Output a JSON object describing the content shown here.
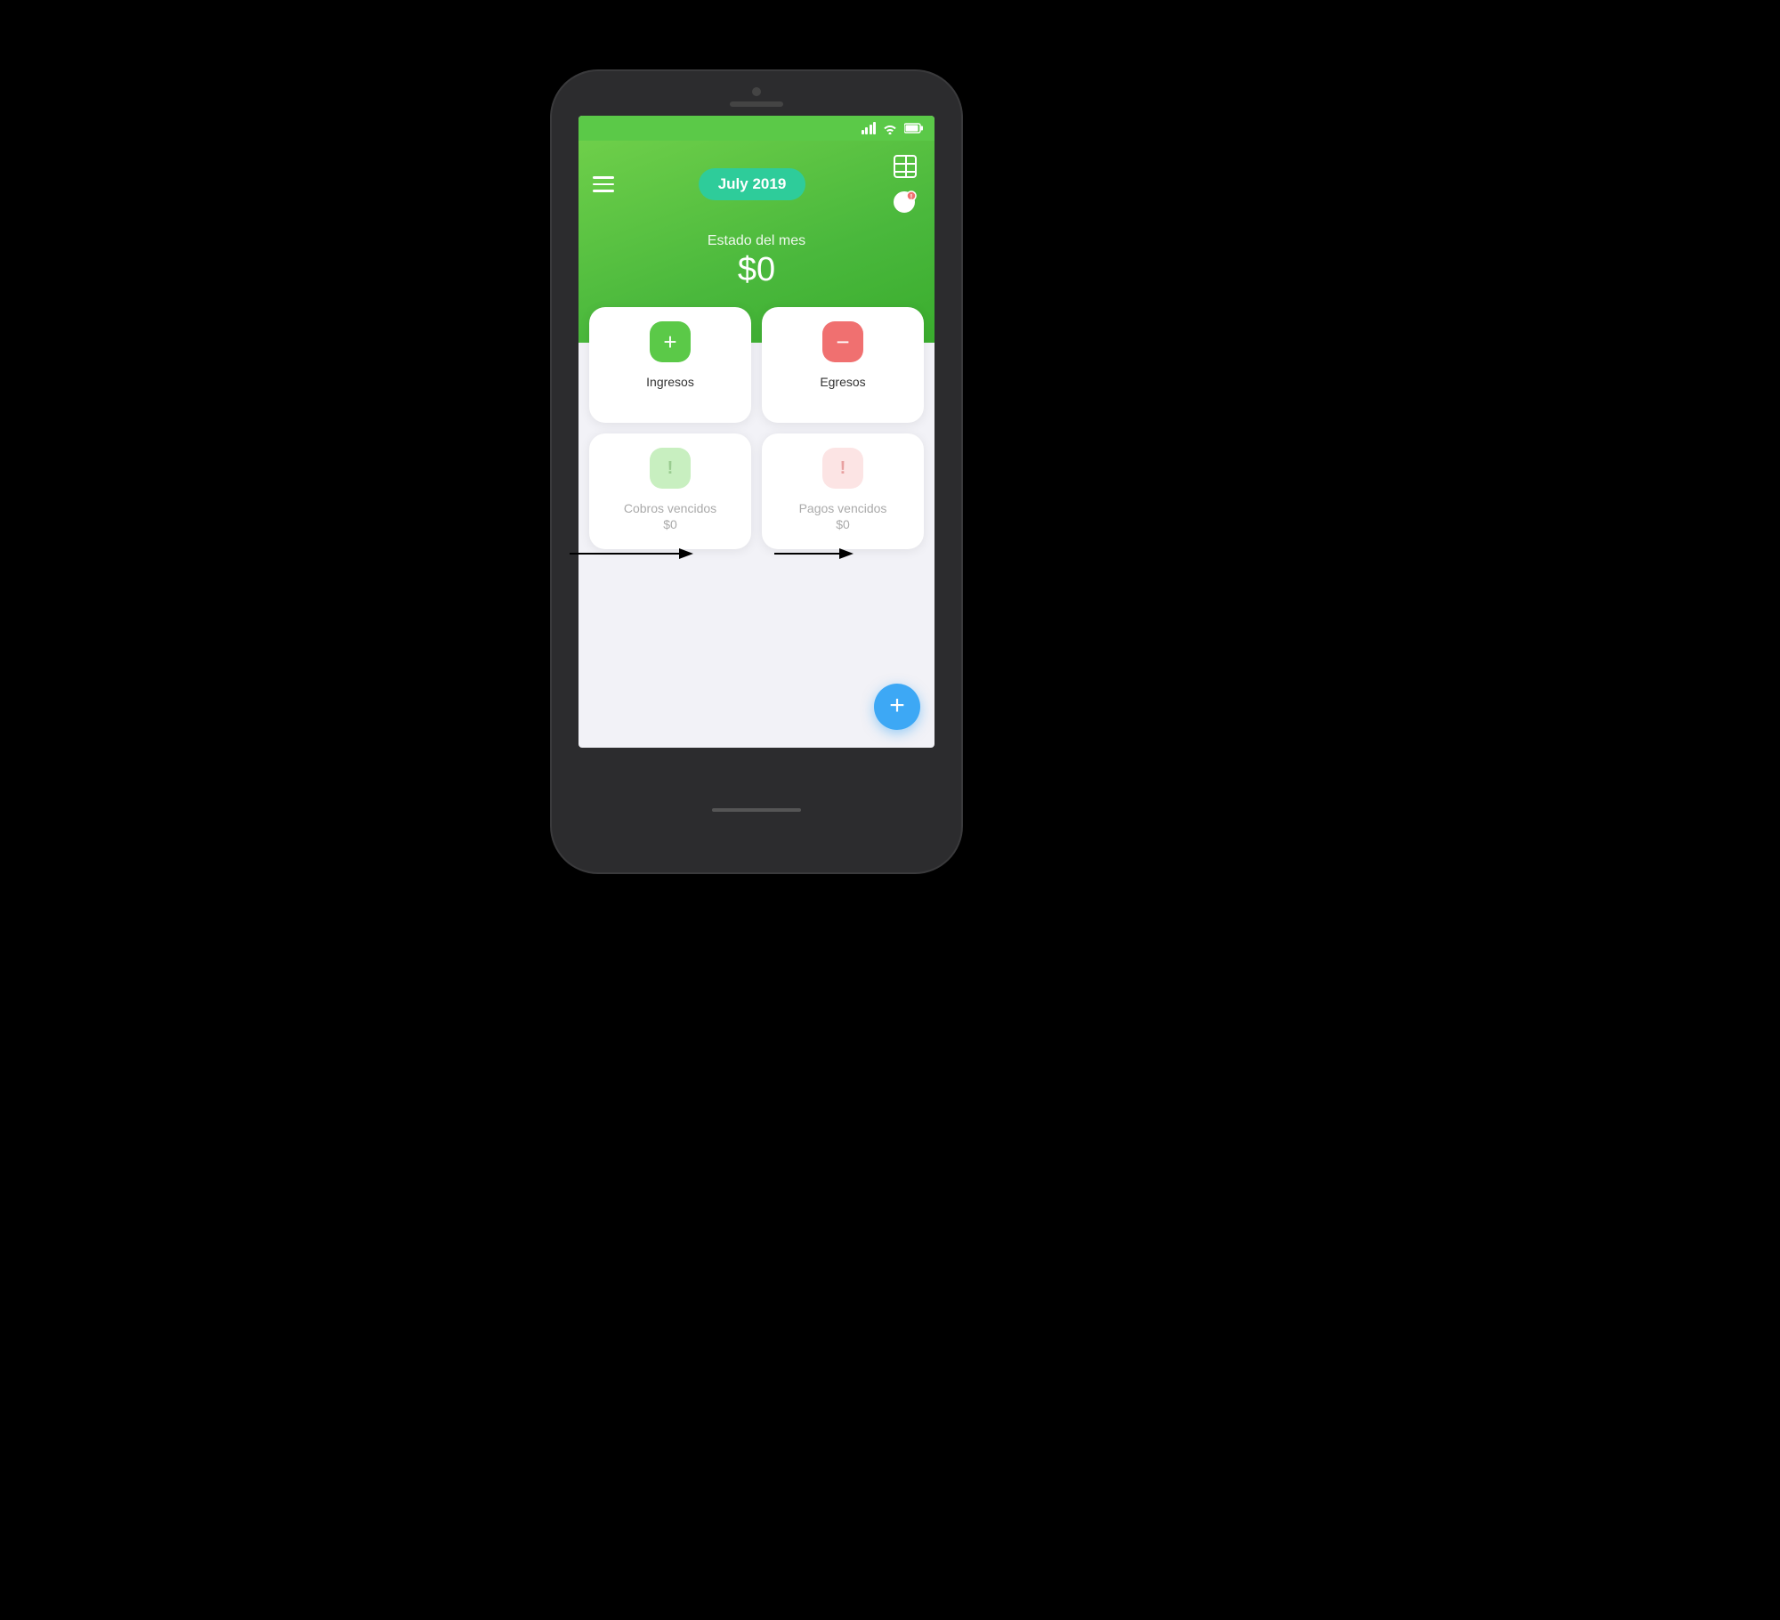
{
  "scene": {
    "background": "#000000"
  },
  "statusBar": {
    "signal": "signal-icon",
    "wifi": "wifi-icon",
    "battery": "battery-icon"
  },
  "header": {
    "monthBadge": "July 2019",
    "estadoLabel": "Estado del mes",
    "estadoAmount": "$0",
    "menuIcon": "menu-icon",
    "tableIcon": "table-icon",
    "dollarIcon": "dollar-alert-icon"
  },
  "cards": [
    {
      "id": "ingresos",
      "iconType": "green",
      "iconLabel": "+",
      "label": "Ingresos",
      "amount": null,
      "muted": false
    },
    {
      "id": "egresos",
      "iconType": "red",
      "iconLabel": "−",
      "label": "Egresos",
      "amount": null,
      "muted": false
    },
    {
      "id": "cobros-vencidos",
      "iconType": "green-light",
      "iconLabel": "!",
      "label": "Cobros vencidos",
      "amount": "$0",
      "muted": true
    },
    {
      "id": "pagos-vencidos",
      "iconType": "red-light",
      "iconLabel": "!",
      "label": "Pagos vencidos",
      "amount": "$0",
      "muted": true
    }
  ],
  "fab": {
    "label": "+"
  }
}
